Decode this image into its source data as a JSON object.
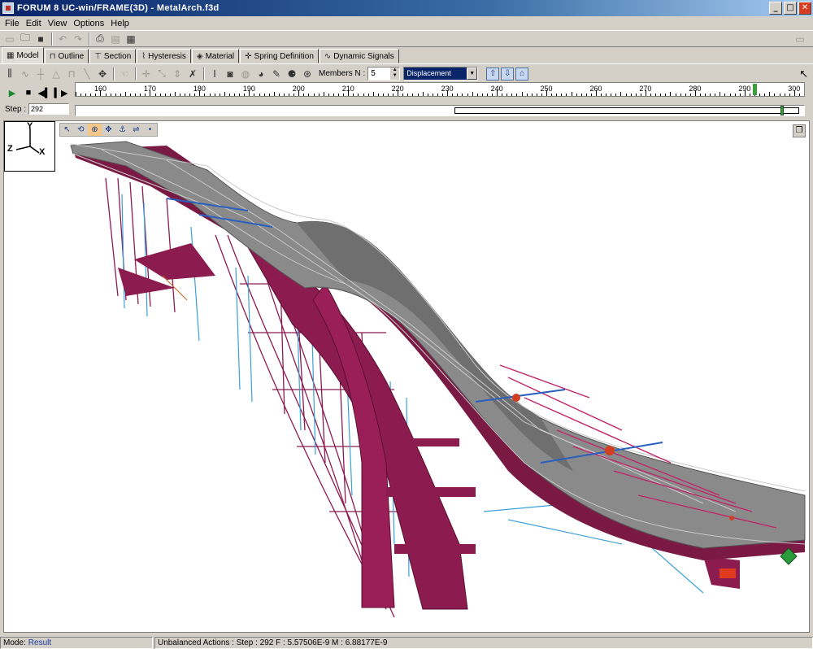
{
  "window": {
    "title": "FORUM 8  UC-win/FRAME(3D) - MetalArch.f3d",
    "minimize": "_",
    "maximize": "□",
    "close": "✕"
  },
  "menu": [
    "File",
    "Edit",
    "View",
    "Options",
    "Help"
  ],
  "tabs": [
    "Model",
    "Outline",
    "Section",
    "Hysteresis",
    "Material",
    "Spring Definition",
    "Dynamic Signals"
  ],
  "toolbar2": {
    "members_label": "Members N :",
    "members_value": "5",
    "result_type": "Displacement"
  },
  "animation": {
    "step_label": "Step :",
    "step_value": "292",
    "ruler_ticks": [
      "160",
      "170",
      "180",
      "190",
      "200",
      "210",
      "220",
      "230",
      "240",
      "250",
      "260",
      "270",
      "280",
      "290",
      "300"
    ],
    "ruler_start": 155,
    "ruler_end": 302,
    "current_step": 292,
    "range_start_fraction": 0.52,
    "thumb_fraction": 0.968
  },
  "axes": {
    "y": "Y",
    "z": "Z",
    "x": "X"
  },
  "status": {
    "mode_label": "Mode:",
    "mode_value": "Result",
    "message": "Unbalanced Actions : Step : 292 F : 5.57506E-9 M : 6.88177E-9"
  },
  "colors": {
    "titlebar": "#0a246a",
    "arch": "#8c1b4f",
    "deck": "#7a7a7a",
    "cable": "#3aa0d8"
  }
}
